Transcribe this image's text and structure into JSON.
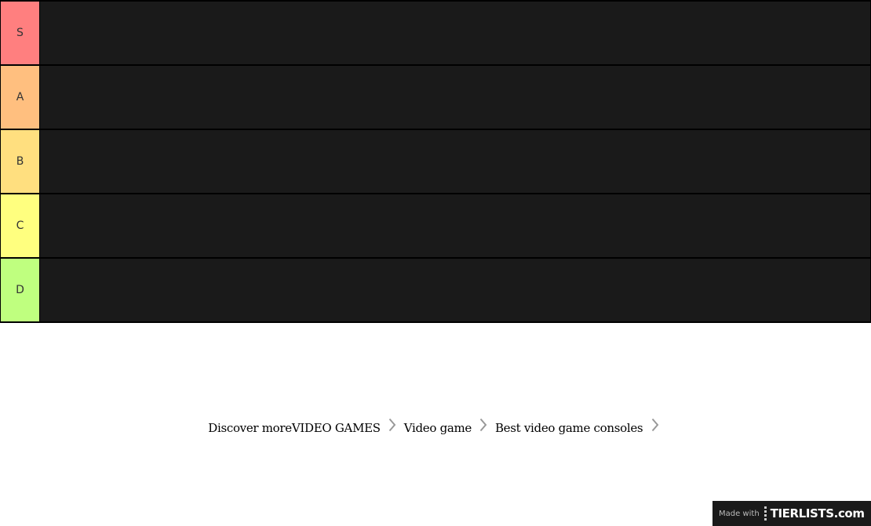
{
  "tiers": [
    {
      "label": "S",
      "color": "#ff7f7f"
    },
    {
      "label": "A",
      "color": "#ffbf7f"
    },
    {
      "label": "B",
      "color": "#ffdf7f"
    },
    {
      "label": "C",
      "color": "#ffff7f"
    },
    {
      "label": "D",
      "color": "#bfff7f"
    }
  ],
  "breadcrumb": {
    "prefix": "Discover more",
    "items": [
      "VIDEO GAMES",
      "Video game",
      "Best video game consoles"
    ]
  },
  "watermark": {
    "made_with": "Made with",
    "logo": "TIERLISTS.com"
  }
}
